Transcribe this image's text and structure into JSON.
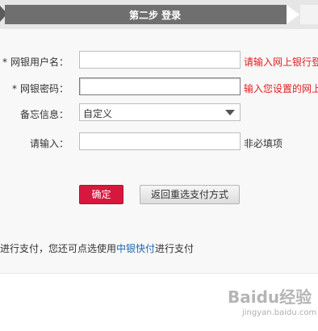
{
  "step_bar": {
    "title": "第二步 登录"
  },
  "form": {
    "username": {
      "required_mark": "*",
      "label": "网银用户名：",
      "value": "",
      "hint": "请输入网上银行登"
    },
    "password": {
      "required_mark": "*",
      "label": "网银密码：",
      "value": "",
      "hint": "输入您设置的网上"
    },
    "memo": {
      "label": "备忘信息：",
      "selected": "自定义"
    },
    "extra": {
      "label": "请输入：",
      "value": "",
      "hint": "非必填项"
    }
  },
  "buttons": {
    "confirm": "确定",
    "reselect": "返回重选支付方式"
  },
  "footnote": {
    "prefix": "进行支付，您还可点选使用",
    "link": "中银快付",
    "suffix": "进行支付"
  },
  "watermark": {
    "text": "Baidu经验",
    "sub": "jingyan.baidu.com"
  },
  "colors": {
    "accent_red": "#d6183e",
    "hint_red": "#e02020",
    "link_blue": "#1a66b3"
  }
}
